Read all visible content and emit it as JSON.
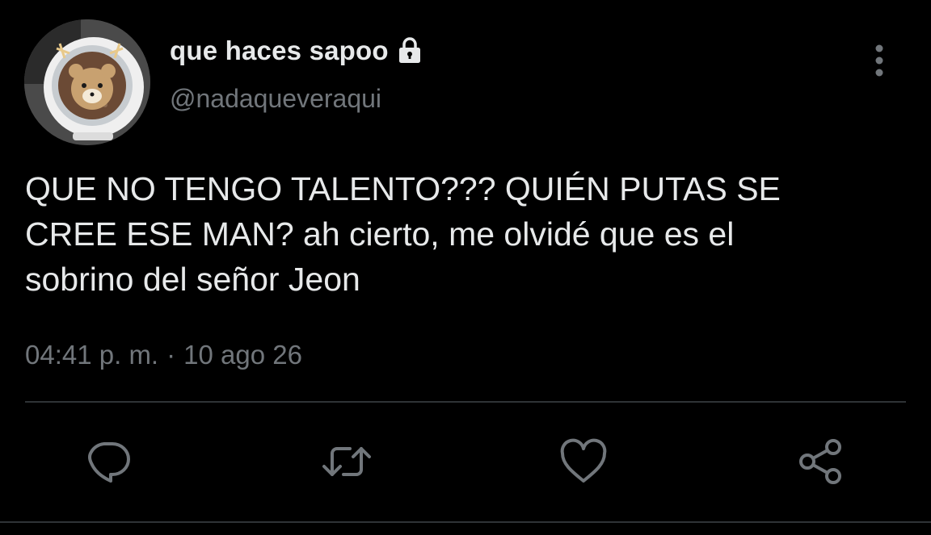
{
  "tweet": {
    "display_name": "que haces sapoo",
    "handle": "@nadaqueveraqui",
    "protected_icon": "lock-icon",
    "text": "QUE NO TENGO TALENTO??? QUIÉN PUTAS SE\nCREE ESE MAN? ah cierto, me olvidé que es el\nsobrino del señor Jeon",
    "time": "04:41 p. m.",
    "separator": "·",
    "date": "10 ago 26"
  },
  "actions": [
    {
      "icon": "reply-icon"
    },
    {
      "icon": "retweet-icon"
    },
    {
      "icon": "like-icon"
    },
    {
      "icon": "share-icon"
    }
  ],
  "colors": {
    "background": "#000000",
    "text": "#e7e9ea",
    "secondary_text": "#71767b",
    "divider": "#2f3336"
  }
}
